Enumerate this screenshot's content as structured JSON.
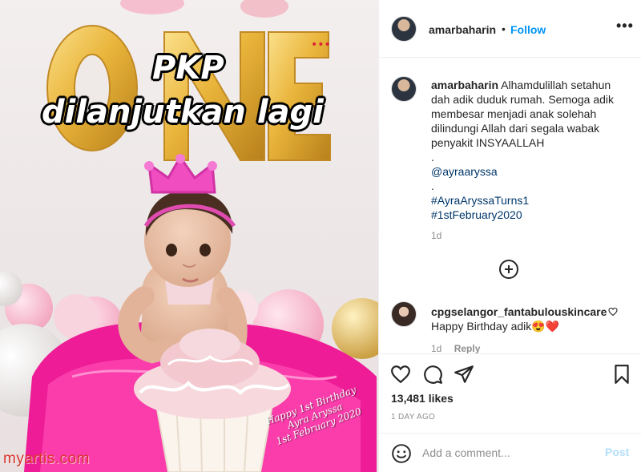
{
  "media": {
    "overlay_line1": "PKP",
    "overlay_line2": "dilanjutkan lagi",
    "balloon_letters": "ONE",
    "cake_caption_line1": "Happy 1st Birthday",
    "cake_caption_line2": "Ayra Aryssa",
    "cake_caption_line3": "1st February 2020",
    "watermark": "myartis.com"
  },
  "header": {
    "username": "amarbaharin",
    "dot": "•",
    "follow_label": "Follow",
    "more_icon": "more-dots-icon",
    "more_glyph": "•••"
  },
  "caption": {
    "username": "amarbaharin",
    "text": "Alhamdulillah setahun dah adik duduk rumah. Semoga adik membesar menjadi anak solehah dilindungi Allah dari segala wabak penyakit INSYAALLAH",
    "sep1": ".",
    "mention": "@ayraaryssa",
    "sep2": ".",
    "hashtag1": "#AyraAryssaTurns1",
    "hashtag2": "#1stFebruary2020",
    "time": "1d"
  },
  "comment": {
    "username": "cpgselangor_fantabulouskincare",
    "text": "Happy Birthday adik😍❤️",
    "time": "1d",
    "reply_label": "Reply"
  },
  "actions": {
    "likes": "13,481 likes",
    "date": "1 DAY AGO"
  },
  "add_comment": {
    "placeholder": "Add a comment...",
    "post_label": "Post"
  },
  "colors": {
    "accent": "#0095f6",
    "link": "#00376b",
    "post_disabled": "#b2dffc",
    "watermark": "#d8332b",
    "tutu_pink": "#f0169a",
    "balloon_gold": "#e9b43a"
  }
}
